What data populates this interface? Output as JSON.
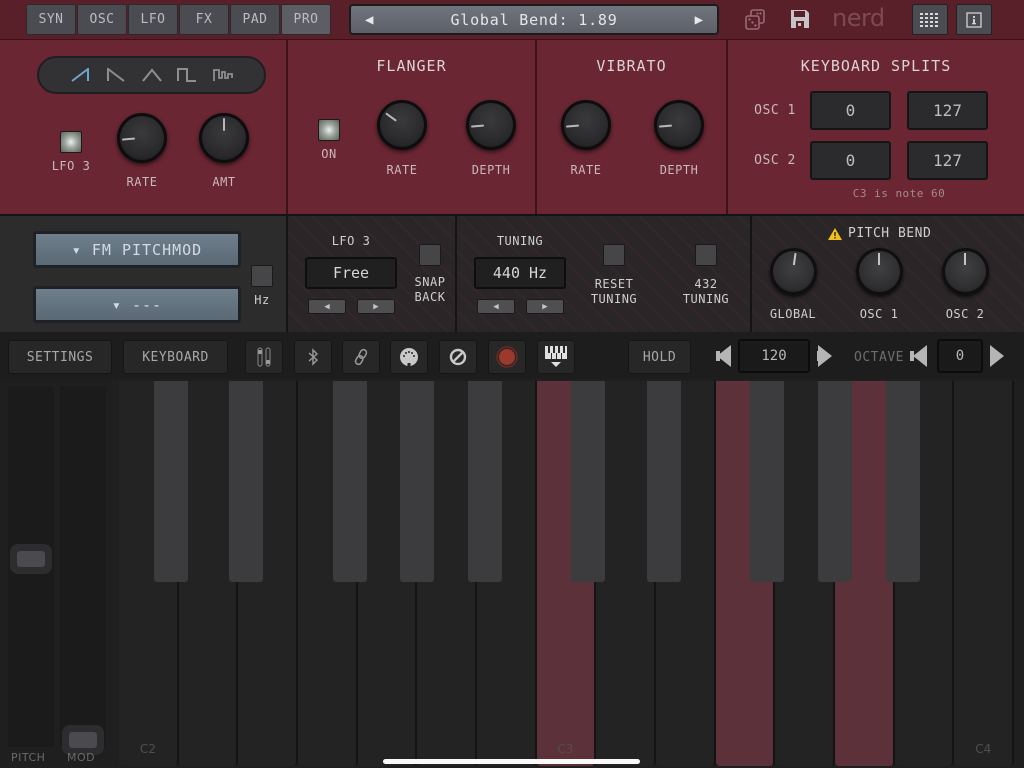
{
  "topbar": {
    "tabs": [
      {
        "label": "SYN",
        "active": false
      },
      {
        "label": "OSC",
        "active": false
      },
      {
        "label": "LFO",
        "active": false
      },
      {
        "label": "FX",
        "active": false
      },
      {
        "label": "PAD",
        "active": false
      },
      {
        "label": "PRO",
        "active": true
      }
    ],
    "preset": {
      "name": "Global Bend: 1.89",
      "prev_icon": "triangle-left-icon",
      "next_icon": "triangle-right-icon"
    },
    "icons": [
      "dice-icon",
      "save-icon",
      "grid-icon",
      "info-icon"
    ],
    "logo": "nerd"
  },
  "lfo3": {
    "waveforms": [
      {
        "name": "saw-up",
        "selected": true
      },
      {
        "name": "saw-down",
        "selected": false
      },
      {
        "name": "triangle",
        "selected": false
      },
      {
        "name": "square",
        "selected": false
      },
      {
        "name": "pulse",
        "selected": false
      }
    ],
    "toggle_label": "LFO 3",
    "knobs": [
      {
        "label": "RATE",
        "value_fraction": 0.15
      },
      {
        "label": "AMT",
        "value_fraction": 0.5
      }
    ]
  },
  "flanger": {
    "title": "FLANGER",
    "on_label": "ON",
    "knobs": [
      {
        "label": "RATE",
        "value_fraction": 0.3
      },
      {
        "label": "DEPTH",
        "value_fraction": 0.15
      }
    ]
  },
  "vibrato": {
    "title": "VIBRATO",
    "knobs": [
      {
        "label": "RATE",
        "value_fraction": 0.15
      },
      {
        "label": "DEPTH",
        "value_fraction": 0.15
      }
    ]
  },
  "keyboard_splits": {
    "title": "KEYBOARD SPLITS",
    "rows": [
      {
        "label": "OSC 1",
        "low": "0",
        "high": "127"
      },
      {
        "label": "OSC 2",
        "low": "0",
        "high": "127"
      }
    ],
    "note": "C3 is note 60"
  },
  "mod_routing": {
    "source": "▾ FM PITCHMOD",
    "target": "▾ ---",
    "hz_label": "Hz"
  },
  "lfo3_sync": {
    "title": "LFO 3",
    "value": "Free",
    "snap_back_line1": "SNAP",
    "snap_back_line2": "BACK"
  },
  "tuning": {
    "title": "TUNING",
    "value": "440 Hz",
    "reset_line1": "RESET",
    "reset_line2": "TUNING",
    "t432_line1": "432",
    "t432_line2": "TUNING"
  },
  "pitch_bend": {
    "title": "PITCH BEND",
    "warning_icon": "warning-icon",
    "knobs": [
      {
        "label": "GLOBAL",
        "value_fraction": 0.53
      },
      {
        "label": "OSC 1",
        "value_fraction": 0.5
      },
      {
        "label": "OSC 2",
        "value_fraction": 0.5
      }
    ]
  },
  "toolbar": {
    "settings": "SETTINGS",
    "keyboard": "KEYBOARD",
    "icons": [
      "sliders-icon",
      "bluetooth-icon",
      "link-icon",
      "midi-icon",
      "disable-icon",
      "record-icon",
      "keyboard-icon"
    ],
    "hold": "HOLD",
    "tempo": "120",
    "octave_label": "OCTAVE",
    "octave": "0",
    "record_color": "#9b3a2c"
  },
  "keyboard": {
    "wheels": [
      {
        "label": "PITCH",
        "value_fraction": 0.5
      },
      {
        "label": "MOD",
        "value_fraction": 0.0
      }
    ],
    "white_keys": [
      {
        "note": "C2",
        "label": "C2",
        "pressed": false
      },
      {
        "note": "D2",
        "label": "",
        "pressed": false
      },
      {
        "note": "E2",
        "label": "",
        "pressed": false
      },
      {
        "note": "F2",
        "label": "",
        "pressed": false
      },
      {
        "note": "G2",
        "label": "",
        "pressed": false
      },
      {
        "note": "A2",
        "label": "",
        "pressed": false
      },
      {
        "note": "B2",
        "label": "",
        "pressed": false
      },
      {
        "note": "C3",
        "label": "C3",
        "pressed": true
      },
      {
        "note": "D3",
        "label": "",
        "pressed": false
      },
      {
        "note": "E3",
        "label": "",
        "pressed": false
      },
      {
        "note": "F3",
        "label": "",
        "pressed": true
      },
      {
        "note": "G3",
        "label": "",
        "pressed": false
      },
      {
        "note": "A3",
        "label": "",
        "pressed": true
      },
      {
        "note": "B3",
        "label": "",
        "pressed": false
      },
      {
        "note": "C4",
        "label": "C4",
        "pressed": false
      }
    ],
    "black_keys": [
      {
        "note": "C#2",
        "after_white": 0
      },
      {
        "note": "D#2",
        "after_white": 1
      },
      {
        "note": "F#2",
        "after_white": 3
      },
      {
        "note": "G#2",
        "after_white": 4
      },
      {
        "note": "A#2",
        "after_white": 5
      },
      {
        "note": "C#3",
        "after_white": 7
      },
      {
        "note": "D#3",
        "after_white": 8
      },
      {
        "note": "F#3",
        "after_white": 10
      },
      {
        "note": "G#3",
        "after_white": 11
      },
      {
        "note": "A#3",
        "after_white": 12
      }
    ],
    "pressed_color": "#5c313a"
  },
  "colors": {
    "panel_red": "#6a2633",
    "topbar_red": "#5a2029",
    "wave_selected": "#6aa6cf",
    "wave_unselected": "#8e8e8e",
    "warning": "#f2c21b"
  }
}
